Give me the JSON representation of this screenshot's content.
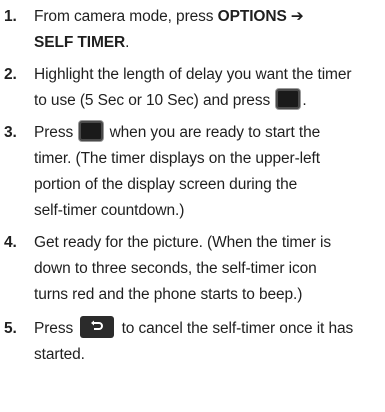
{
  "steps": [
    {
      "number": "1.",
      "line1_text": "From camera mode, press ",
      "line1_bold": "OPTIONS",
      "arrow": "➔",
      "line2_bold": "SELF TIMER",
      "line2_text": "."
    },
    {
      "number": "2.",
      "line1": "Highlight the length of delay you want the timer",
      "line2_text": "to use (5 Sec or 10 Sec) and press",
      "line2_end": ".",
      "key_icon": "center-select-key-icon"
    },
    {
      "number": "3.",
      "line1_start": "Press",
      "line1_end": "when you are ready to start the",
      "line2": "timer. (The timer displays on the upper-left",
      "line3": "portion of the display screen during the",
      "line4": "self-timer countdown.)",
      "key_icon": "center-select-key-icon"
    },
    {
      "number": "4.",
      "line1": "Get ready for the picture. (When the timer is",
      "line2": "down to three seconds, the self-timer icon",
      "line3": "turns red and the phone starts to beep.)"
    },
    {
      "number": "5.",
      "line1_start": "Press",
      "line1_end": "to cancel the self-timer once it has",
      "line2": "started.",
      "key_icon": "back-key-icon"
    }
  ]
}
